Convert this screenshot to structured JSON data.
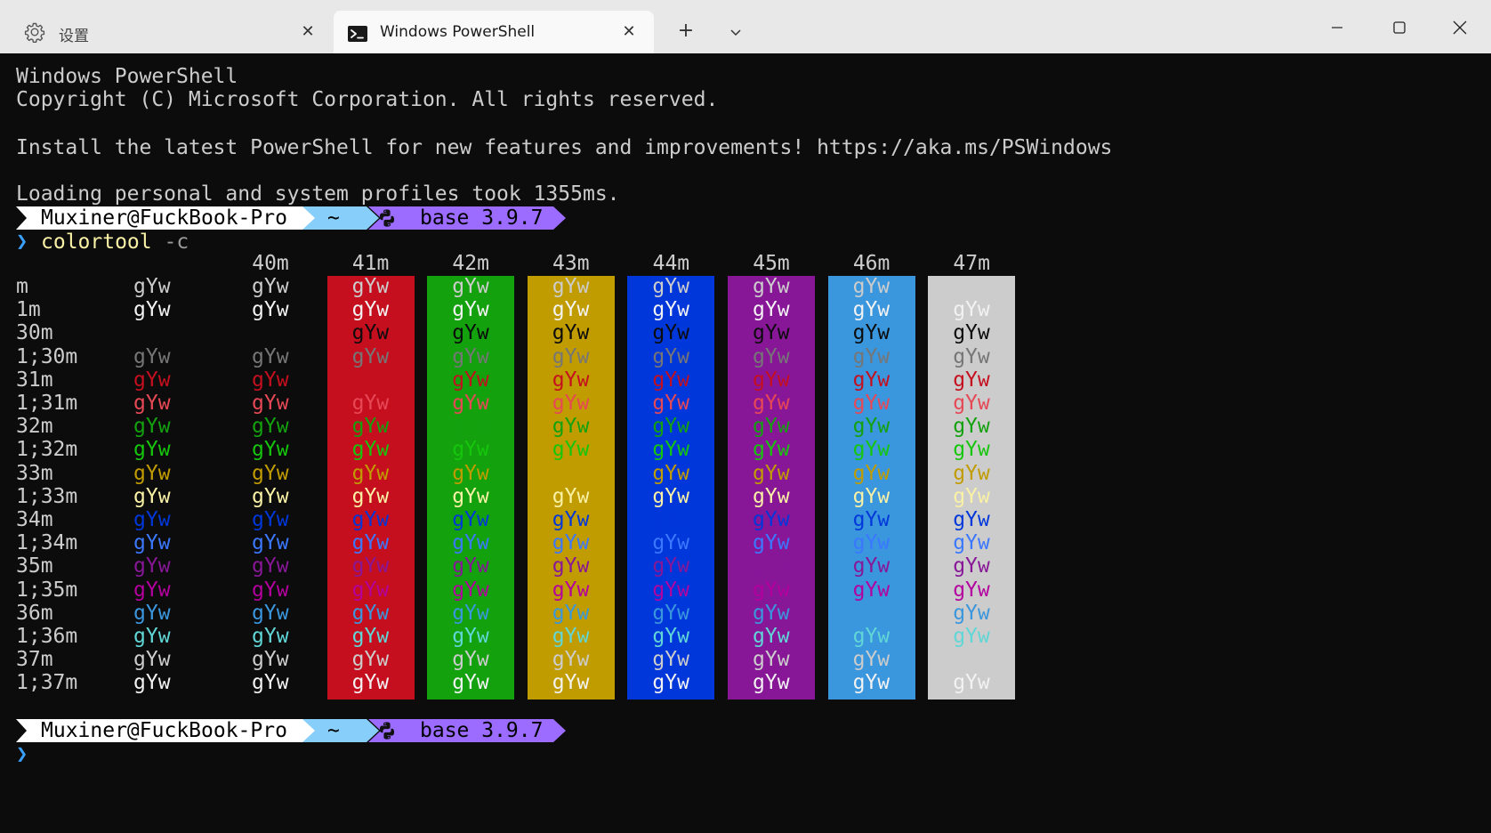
{
  "tabs": [
    {
      "label": "设置",
      "icon": "gear-icon",
      "active": false
    },
    {
      "label": "Windows PowerShell",
      "icon": "terminal-icon",
      "active": true
    }
  ],
  "titlebar": {
    "new_tab": "+",
    "dropdown": "⌵",
    "minimize": "—",
    "maximize": "☐",
    "close": "✕"
  },
  "terminal": {
    "header": [
      "Windows PowerShell",
      "Copyright (C) Microsoft Corporation. All rights reserved.",
      "",
      "Install the latest PowerShell for new features and improvements! https://aka.ms/PSWindows",
      "",
      "Loading personal and system profiles took 1355ms."
    ],
    "prompt": {
      "user": "Muxiner@FuckBook-Pro",
      "path": "~",
      "env": "base 3.9.7",
      "caret": "❯"
    },
    "command": {
      "name": "colortool",
      "arg": "-c"
    },
    "table": {
      "sample": "gYw",
      "col_headers": [
        "40m",
        "41m",
        "42m",
        "43m",
        "44m",
        "45m",
        "46m",
        "47m"
      ],
      "row_labels": [
        "m",
        "1m",
        "30m",
        "1;30m",
        "31m",
        "1;31m",
        "32m",
        "1;32m",
        "33m",
        "1;33m",
        "34m",
        "1;34m",
        "35m",
        "1;35m",
        "36m",
        "1;36m",
        "37m",
        "1;37m"
      ]
    }
  },
  "palette": {
    "background": "#0c0c0c",
    "foreground": "#cccccc",
    "bg_columns": [
      "#0c0c0c",
      "#c50f1f",
      "#13a10e",
      "#c19c00",
      "#0037da",
      "#881798",
      "#3a96dd",
      "#cccccc"
    ],
    "row_fg": {
      "m": "#cccccc",
      "1m": "#f2f2f2",
      "30m": "#0c0c0c",
      "1;30m": "#767676",
      "31m": "#c50f1f",
      "1;31m": "#e74856",
      "32m": "#13a10e",
      "1;32m": "#16c60c",
      "33m": "#c19c00",
      "1;33m": "#f9f1a5",
      "34m": "#0037da",
      "1;34m": "#3b78ff",
      "35m": "#881798",
      "1;35m": "#b4009e",
      "36m": "#3a96dd",
      "1;36m": "#61d6d6",
      "37m": "#cccccc",
      "1;37m": "#f2f2f2"
    },
    "prompt_user_bg": "#ffffff",
    "prompt_path_bg": "#87cefa",
    "prompt_env_bg": "#9b6cff",
    "caret": "#3aa0ff"
  }
}
